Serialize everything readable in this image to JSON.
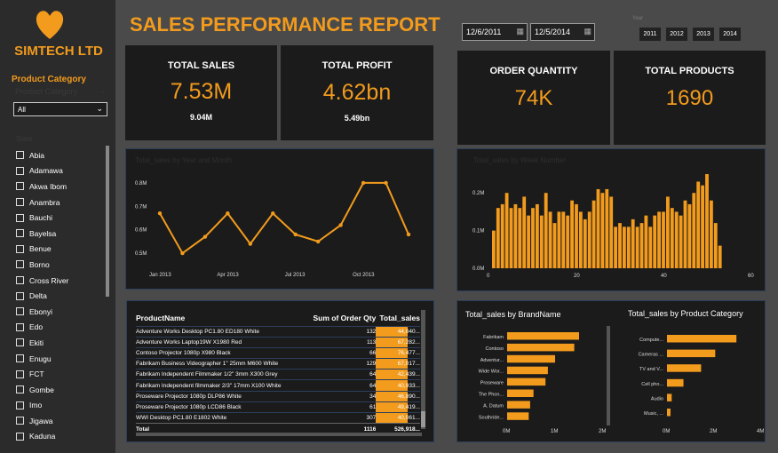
{
  "brand": "SIMTECH LTD",
  "sidebar": {
    "filter_title": "Product Category",
    "filter_ghost": "Product Category",
    "dropdown_value": "All",
    "state_ghost": "State",
    "states": [
      "Abia",
      "Adamawa",
      "Akwa Ibom",
      "Anambra",
      "Bauchi",
      "Bayelsa",
      "Benue",
      "Borno",
      "Cross River",
      "Delta",
      "Ebonyi",
      "Edo",
      "Ekiti",
      "Enugu",
      "FCT",
      "Gombe",
      "Imo",
      "Jigawa",
      "Kaduna"
    ]
  },
  "header": {
    "title": "SALES PERFORMANCE REPORT",
    "start_date": "12/6/2011",
    "end_date": "12/5/2014",
    "year_ghost": "Year",
    "years": [
      "2011",
      "2012",
      "2013",
      "2014"
    ]
  },
  "kpis": {
    "total_sales": {
      "label": "TOTAL SALES",
      "value": "7.53M",
      "sub": "9.04M"
    },
    "total_profit": {
      "label": "TOTAL PROFIT",
      "value": "4.62bn",
      "sub": "5.49bn"
    },
    "order_qty": {
      "label": "ORDER QUANTITY",
      "value": "74K"
    },
    "total_products": {
      "label": "TOTAL PRODUCTS",
      "value": "1690"
    }
  },
  "line_panel": {
    "ghost_title": "Total_sales by Year and Month"
  },
  "week_panel": {
    "ghost_title": "Total_sales by Week Number"
  },
  "colors": {
    "accent": "#f29b1d",
    "panel": "#1b1b1b",
    "background": "#4a4a4a"
  },
  "table": {
    "headers": [
      "ProductName",
      "Sum of Order Qty",
      "Total_sales"
    ],
    "rows": [
      [
        "Adventure Works Desktop PC1.80 ED180 White",
        "132",
        "44,040..."
      ],
      [
        "Adventure Works Laptop19W X1980 Red",
        "113",
        "67,282..."
      ],
      [
        "Contoso Projector 1080p X980 Black",
        "66",
        "76,477..."
      ],
      [
        "Fabrikam Business Videographer 1\" 25mm M600 White",
        "129",
        "67,017..."
      ],
      [
        "Fabrikam Independent Filmmaker 1/2\" 3mm X300 Grey",
        "64",
        "42,439..."
      ],
      [
        "Fabrikam Independent filmmaker 2/3\" 17mm X100 White",
        "64",
        "40,933..."
      ],
      [
        "Proseware Projector 1080p DLP86 White",
        "34",
        "46,890..."
      ],
      [
        "Proseware Projector 1080p LCD86 Black",
        "61",
        "49,419..."
      ],
      [
        "WWI Desktop PC1.80 E1802 White",
        "307",
        "40,061..."
      ]
    ],
    "total": [
      "Total",
      "1116",
      "526,918..."
    ]
  },
  "chart_data": [
    {
      "type": "line",
      "title": "",
      "x": [
        "Jan 2013",
        "Feb 2013",
        "Mar 2013",
        "Apr 2013",
        "May 2013",
        "Jun 2013",
        "Jul 2013",
        "Aug 2013",
        "Sep 2013",
        "Oct 2013",
        "Nov 2013",
        "Dec 2013"
      ],
      "xticks": [
        "Jan 2013",
        "Apr 2013",
        "Jul 2013",
        "Oct 2013"
      ],
      "values": [
        0.67,
        0.5,
        0.57,
        0.67,
        0.54,
        0.67,
        0.58,
        0.55,
        0.62,
        0.8,
        0.8,
        0.58
      ],
      "yticks": [
        "0.5M",
        "0.6M",
        "0.7M",
        "0.8M"
      ],
      "ylim": [
        0.47,
        0.83
      ],
      "color": "#f29b1d"
    },
    {
      "type": "bar",
      "title": "",
      "x": [
        1,
        2,
        3,
        4,
        5,
        6,
        7,
        8,
        9,
        10,
        11,
        12,
        13,
        14,
        15,
        16,
        17,
        18,
        19,
        20,
        21,
        22,
        23,
        24,
        25,
        26,
        27,
        28,
        29,
        30,
        31,
        32,
        33,
        34,
        35,
        36,
        37,
        38,
        39,
        40,
        41,
        42,
        43,
        44,
        45,
        46,
        47,
        48,
        49,
        50,
        51,
        52,
        53
      ],
      "values": [
        0.1,
        0.16,
        0.17,
        0.2,
        0.16,
        0.17,
        0.16,
        0.19,
        0.14,
        0.16,
        0.17,
        0.14,
        0.2,
        0.15,
        0.12,
        0.15,
        0.15,
        0.14,
        0.18,
        0.17,
        0.15,
        0.13,
        0.15,
        0.18,
        0.21,
        0.2,
        0.21,
        0.19,
        0.11,
        0.12,
        0.11,
        0.11,
        0.13,
        0.11,
        0.12,
        0.14,
        0.11,
        0.14,
        0.15,
        0.15,
        0.19,
        0.16,
        0.15,
        0.14,
        0.18,
        0.17,
        0.2,
        0.23,
        0.22,
        0.25,
        0.18,
        0.12,
        0.06
      ],
      "xticks": [
        "0",
        "20",
        "40",
        "60"
      ],
      "yticks": [
        "0.0M",
        "0.1M",
        "0.2M"
      ],
      "ylim": [
        0,
        0.25
      ],
      "xlim": [
        0,
        60
      ],
      "color": "#f29b1d"
    },
    {
      "type": "bar",
      "title": "Total_sales by BrandName",
      "categories": [
        "Fabrikam",
        "Contoso",
        "Adventur...",
        "Wide Wor...",
        "Proseware",
        "The Phon...",
        "A. Datum",
        "Southride..."
      ],
      "values": [
        1.5,
        1.4,
        1.0,
        0.85,
        0.8,
        0.55,
        0.48,
        0.45
      ],
      "xticks": [
        "0M",
        "1M",
        "2M"
      ],
      "xlim": [
        0,
        2
      ],
      "color": "#f29b1d"
    },
    {
      "type": "bar",
      "title": "Total_sales by Product Category",
      "categories": [
        "Compute...",
        "Cameras ...",
        "TV and V...",
        "Cell pho...",
        "Audio",
        "Music, ..."
      ],
      "values": [
        2.95,
        2.05,
        1.45,
        0.7,
        0.2,
        0.15
      ],
      "xticks": [
        "0M",
        "2M",
        "4M"
      ],
      "xlim": [
        0,
        4
      ],
      "color": "#f29b1d"
    }
  ]
}
